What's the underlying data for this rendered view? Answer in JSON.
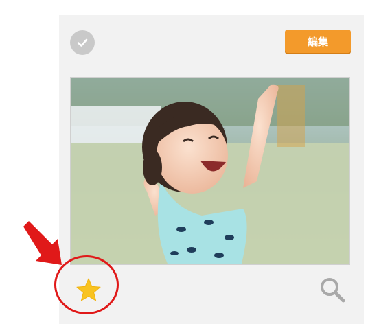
{
  "toolbar": {
    "edit_label": "編集"
  },
  "icons": {
    "select": "check-circle-icon",
    "favorite": "star-icon",
    "zoom": "magnifier-icon"
  },
  "colors": {
    "edit_button": "#f39a2b",
    "favorite_star": "#f8c320",
    "highlight": "#e01919"
  }
}
